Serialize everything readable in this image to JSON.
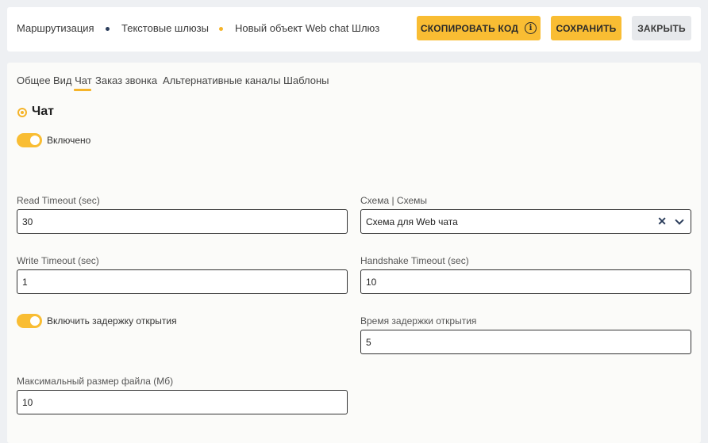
{
  "breadcrumbs": [
    "Маршрутизация",
    "Текстовые шлюзы",
    "Новый объект Web chat Шлюз"
  ],
  "breadcrumb_dot_colors": [
    "#2c3e5c",
    "#f5b42a"
  ],
  "actions": {
    "copy_code": "СКОПИРОВАТЬ КОД",
    "save": "СОХРАНИТЬ",
    "close": "ЗАКРЫТЬ"
  },
  "tabs": [
    "Общее",
    "Вид Чат",
    "Заказ звонка",
    "Альтернативные каналы",
    "Шаблоны"
  ],
  "active_tab": "Вид Чат",
  "section": {
    "title": "Чат",
    "enabled_label": "Включено",
    "enabled": true
  },
  "fields": {
    "read_timeout": {
      "label": "Read Timeout (sec)",
      "value": "30"
    },
    "scheme": {
      "label": "Схема | Схемы",
      "value": "Схема для Web чата"
    },
    "write_timeout": {
      "label": "Write Timeout (sec)",
      "value": "1"
    },
    "handshake_timeout": {
      "label": "Handshake Timeout (sec)",
      "value": "10"
    },
    "open_delay_toggle": {
      "label": "Включить задержку открытия",
      "enabled": true
    },
    "open_delay_time": {
      "label": "Время задержки открытия",
      "value": "5"
    },
    "max_file_size": {
      "label": "Максимальный размер файла (Мб)",
      "value": "10"
    }
  },
  "colors": {
    "accent": "#f9bd33",
    "secondary_button": "#e7e9ec",
    "background": "#eef0f3",
    "panel": "#fbfbf9"
  }
}
